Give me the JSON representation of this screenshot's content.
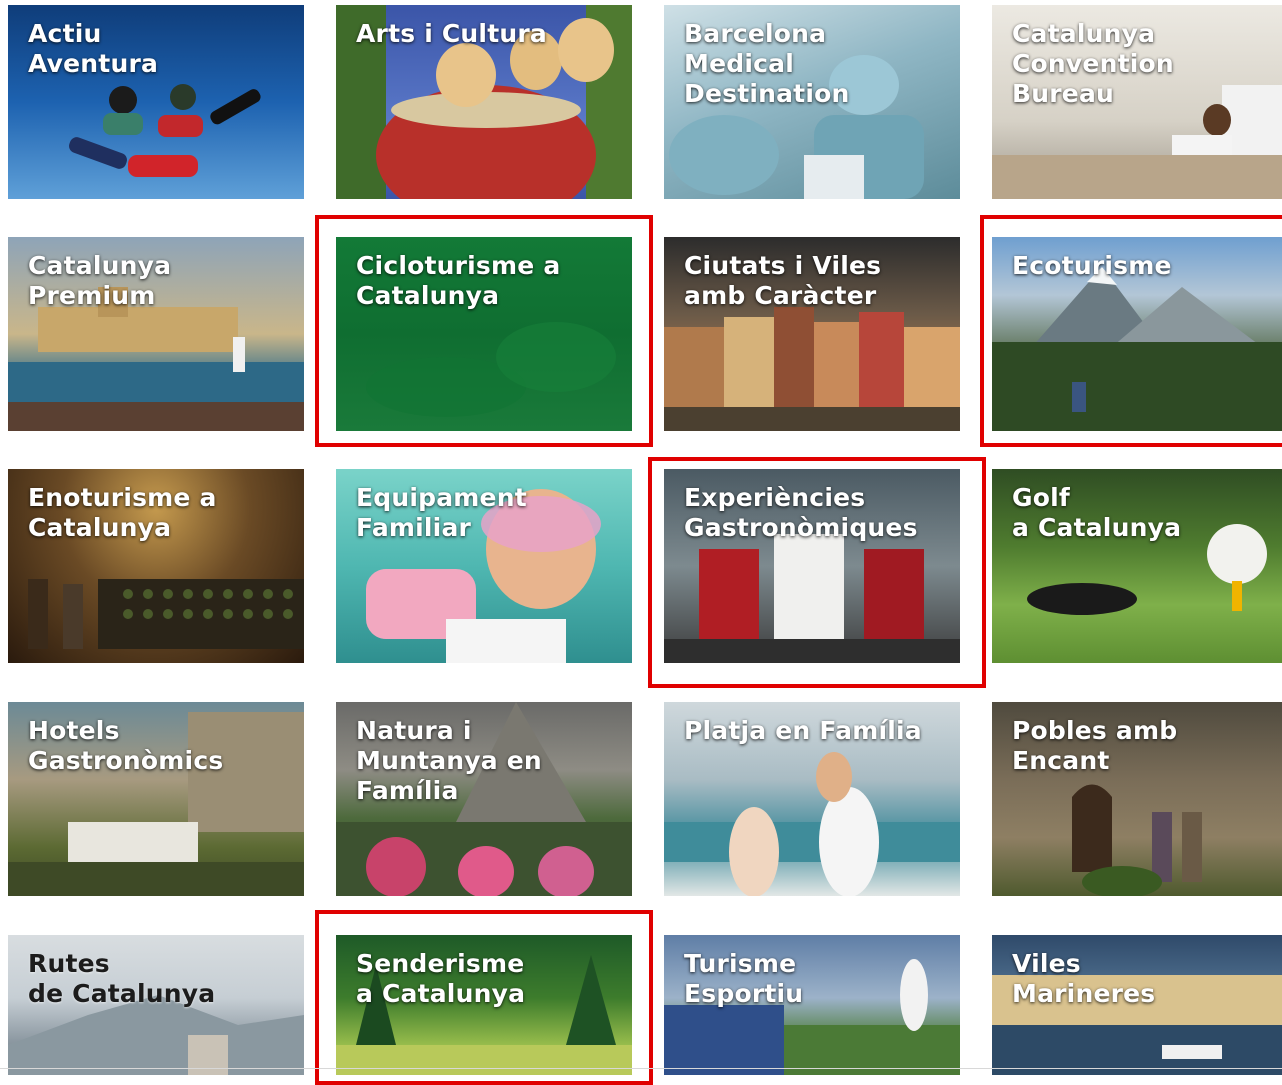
{
  "tiles": [
    {
      "id": "actiu",
      "label": "Actiu\nAventura"
    },
    {
      "id": "arts",
      "label": "Arts i Cultura"
    },
    {
      "id": "bcn",
      "label": "Barcelona\nMedical\nDestination"
    },
    {
      "id": "ccb",
      "label": "Catalunya\nConvention\nBureau"
    },
    {
      "id": "premium",
      "label": "Catalunya\nPremium"
    },
    {
      "id": "ciclo",
      "label": "Cicloturisme a\nCatalunya"
    },
    {
      "id": "ciutats",
      "label": "Ciutats i Viles\namb Caràcter"
    },
    {
      "id": "eco",
      "label": "Ecoturisme"
    },
    {
      "id": "eno",
      "label": "Enoturisme a\nCatalunya"
    },
    {
      "id": "equip",
      "label": "Equipament\nFamiliar"
    },
    {
      "id": "exp",
      "label": "Experiències\nGastronòmiques"
    },
    {
      "id": "golf",
      "label": "Golf\na Catalunya"
    },
    {
      "id": "hotels",
      "label": "Hotels\nGastronòmics"
    },
    {
      "id": "natura",
      "label": "Natura i\nMuntanya en\nFamília"
    },
    {
      "id": "platja",
      "label": "Platja en Família"
    },
    {
      "id": "pobles",
      "label": "Pobles amb\nEncant"
    },
    {
      "id": "rutes",
      "label": "Rutes\nde Catalunya"
    },
    {
      "id": "sender",
      "label": "Senderisme\na Catalunya"
    },
    {
      "id": "turisme",
      "label": "Turisme\nEsportiu"
    },
    {
      "id": "viles",
      "label": "Viles\nMarineres"
    }
  ],
  "highlighted": [
    "ciclo",
    "eco",
    "exp",
    "sender"
  ],
  "colors": {
    "highlight": "#e00000",
    "label": "#ffffff"
  }
}
